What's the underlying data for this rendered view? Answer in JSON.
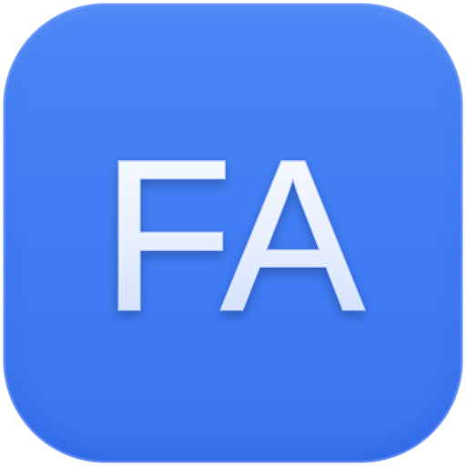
{
  "app_icon": {
    "text": "FA",
    "background_color": "#3f7bf4",
    "text_color": "#eef4ff"
  }
}
